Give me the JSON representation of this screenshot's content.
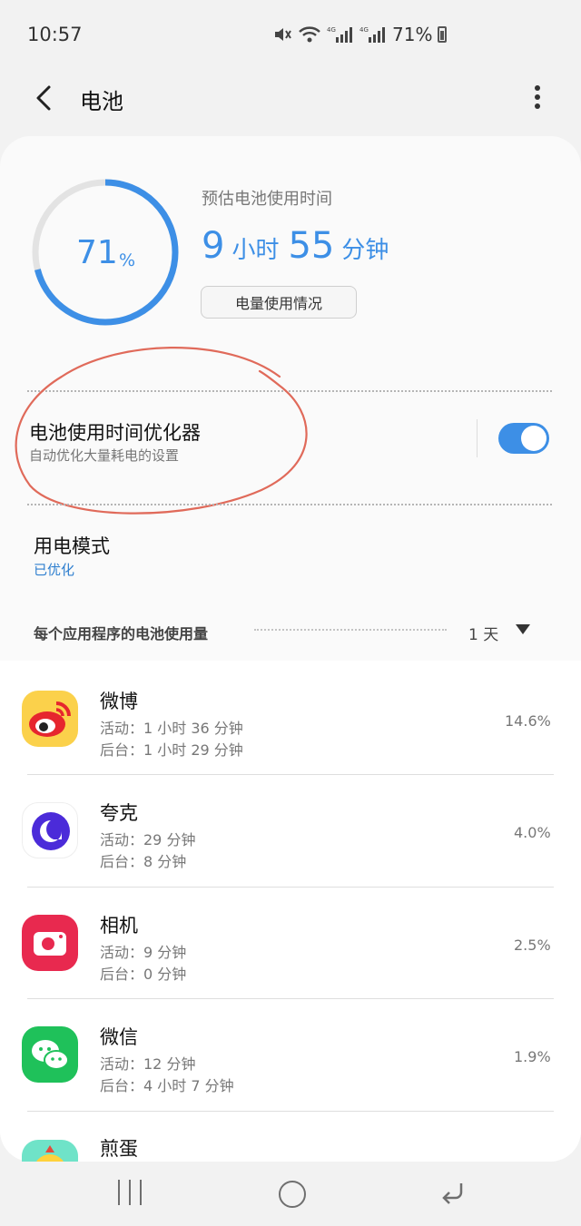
{
  "status_bar": {
    "time": "10:57",
    "battery_text": "71%"
  },
  "header": {
    "title": "电池"
  },
  "battery": {
    "percent": "71",
    "percent_symbol": "%",
    "percent_value": 71,
    "estimate_label": "预估电池使用时间",
    "hours": "9",
    "hours_unit": "小时",
    "minutes": "55",
    "minutes_unit": "分钟",
    "usage_button": "电量使用情况"
  },
  "optimizer": {
    "title": "电池使用时间优化器",
    "subtitle": "自动优化大量耗电的设置",
    "enabled": true
  },
  "power_mode": {
    "title": "用电模式",
    "value": "已优化"
  },
  "app_usage": {
    "title": "每个应用程序的电池使用量",
    "range": "1 天",
    "apps": [
      {
        "name": "微博",
        "active": "活动：1 小时 36 分钟",
        "background": "后台：1 小时 29 分钟",
        "percent": "14.6%",
        "icon": "weibo-icon"
      },
      {
        "name": "夸克",
        "active": "活动：29 分钟",
        "background": "后台：8 分钟",
        "percent": "4.0%",
        "icon": "quark-icon"
      },
      {
        "name": "相机",
        "active": "活动：9 分钟",
        "background": "后台：0 分钟",
        "percent": "2.5%",
        "icon": "camera-icon"
      },
      {
        "name": "微信",
        "active": "活动：12 分钟",
        "background": "后台：4 小时 7 分钟",
        "percent": "1.9%",
        "icon": "wechat-icon"
      },
      {
        "name": "煎蛋",
        "icon": "jandan-icon"
      }
    ]
  },
  "colors": {
    "accent": "#3d8fe6",
    "annotation": "#e06a5a"
  }
}
